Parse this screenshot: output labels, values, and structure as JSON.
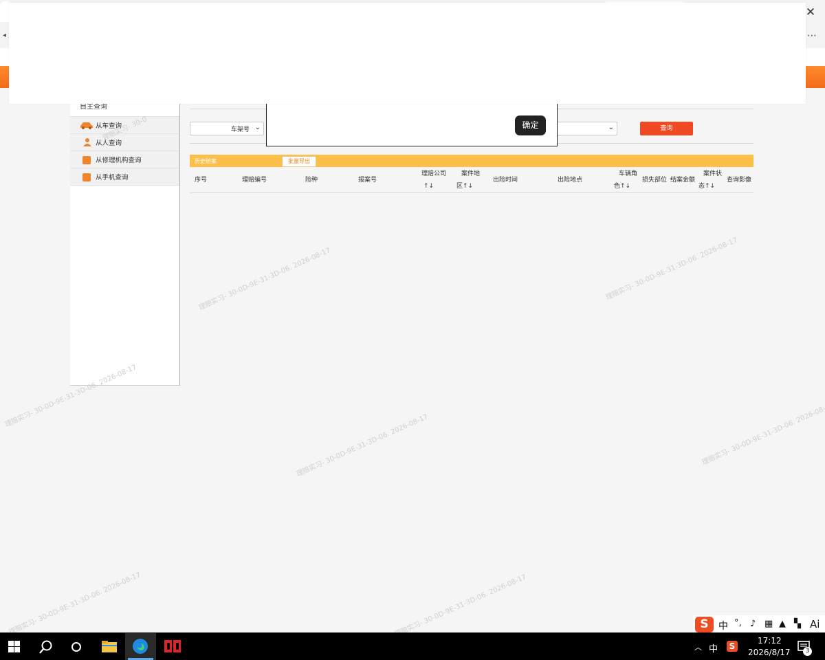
{
  "sidebar": {
    "title": "自主查询",
    "items": [
      {
        "label": "从车查询"
      },
      {
        "label": "从人查询"
      },
      {
        "label": "从修理机构查询"
      },
      {
        "label": "从手机查询"
      }
    ]
  },
  "filters": {
    "select1_value": "车架号",
    "select2_value": ""
  },
  "modal": {
    "ok_label": "确定"
  },
  "query_button": "查询",
  "history": {
    "title": "历史赔案",
    "export_label": "批量导出",
    "columns": [
      "序号",
      "理赔编号",
      "险种",
      "报案号",
      "理赔公司↑↓",
      "案件地区↑↓",
      "出险时间",
      "出险地点",
      "车辆角色↑↓",
      "损失部位",
      "结案金额",
      "案件状态↑↓",
      "查询影像"
    ],
    "col_line1": [
      "序号",
      "理赔编号",
      "险种",
      "报案号",
      "理赔公司",
      "案件地",
      "出险时间",
      "出险地点",
      "车辆角",
      "损失部位",
      "结案金额",
      "案件状",
      "查询影像"
    ],
    "col_line2": [
      "",
      "",
      "",
      "",
      "↑↓",
      "区↑↓",
      "",
      "",
      "色↑↓",
      "",
      "",
      "态↑↓",
      ""
    ]
  },
  "watermark_text": "理赔实习- 30-0D-9E-31-3D-06. 2026-08-17",
  "watermark_partial": "理赔实习- 30-0",
  "taskbar": {
    "time": "17:12",
    "date": "2026/8/17",
    "ime_lang": "中",
    "notification_count": "3",
    "ime_bar_lang": "中",
    "ime_ai": "Ai"
  },
  "colors": {
    "orange_header": "#f36b17",
    "yellow_bar": "#fbbf4a",
    "query_red": "#f04a25"
  }
}
